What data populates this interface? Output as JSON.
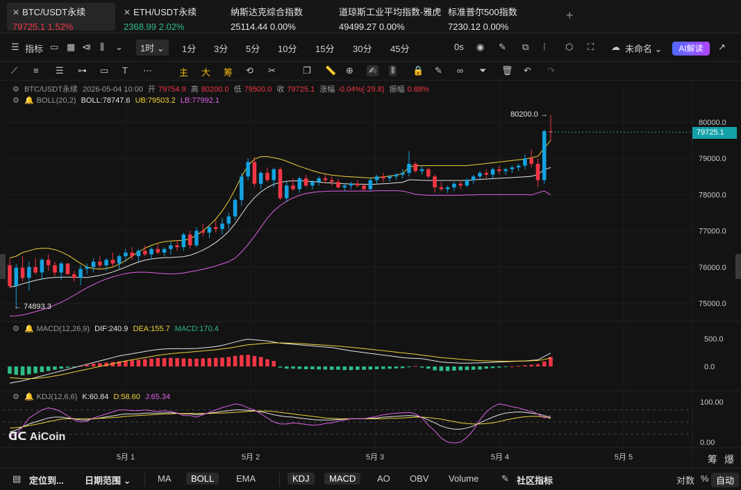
{
  "tabs": [
    {
      "name": "BTC/USDT永续",
      "price": "79725.1",
      "change": "1.52%",
      "dir": "down",
      "active": true
    },
    {
      "name": "ETH/USDT永续",
      "price": "2368.99",
      "change": "2.02%",
      "dir": "up",
      "active": false
    }
  ],
  "indices": [
    {
      "name": "纳斯达克综合指数",
      "price": "25114.44",
      "change": "0.00%"
    },
    {
      "name": "道琼斯工业平均指数-雅虎",
      "price": "49499.27",
      "change": "0.00%"
    },
    {
      "name": "标准普尔500指数",
      "price": "7230.12",
      "change": "0.00%"
    }
  ],
  "toolbar": {
    "indicators_label": "指标",
    "timeframe_selected": "1时",
    "timeframes": [
      "1分",
      "3分",
      "5分",
      "10分",
      "15分",
      "30分",
      "45分"
    ],
    "zero_sec": "0s",
    "unnamed_label": "未命名",
    "ai_label": "AI解读"
  },
  "drawbar": {
    "main_label": "主",
    "da_label": "大",
    "chip_label": "筹"
  },
  "ohlc": {
    "symbol": "BTC/USDT永续",
    "datetime": "2026-05-04 10:00",
    "open_label": "开",
    "open": "79754.9",
    "high_label": "高",
    "high": "80200.0",
    "low_label": "低",
    "low": "79500.0",
    "close_label": "收",
    "close": "79725.1",
    "change_label": "涨幅",
    "change": "-0.04%(-29.8)",
    "amp_label": "振幅",
    "amp": "0.88%"
  },
  "boll": {
    "title": "BOLL(20,2)",
    "boll": "BOLL:78747.6",
    "ub": "UB:79503.2",
    "lb": "LB:77992.1"
  },
  "macd": {
    "title": "MACD(12,26,9)",
    "dif": "DIF:240.9",
    "dea": "DEA:155.7",
    "macd": "MACD:170.4"
  },
  "kdj": {
    "title": "KDJ(12,6,6)",
    "k": "K:60.84",
    "d": "D:58.60",
    "j": "J:65.34"
  },
  "price_axis": [
    "80000.0",
    "79000.0",
    "78000.0",
    "77000.0",
    "76000.0",
    "75000.0"
  ],
  "macd_axis": [
    "500.0",
    "0.0"
  ],
  "kdj_axis": [
    "100.00",
    "0.00"
  ],
  "date_axis": [
    "5月 1",
    "5月 2",
    "5月 3",
    "5月 4",
    "5月 5"
  ],
  "last_price": "79725.1",
  "max_annotation": "80200.0 →",
  "min_annotation": "← 74893.3",
  "corner_right": [
    "筹",
    "爆"
  ],
  "logo_text": "AiCoin",
  "bottombar": {
    "locate": "定位到...",
    "range": "日期范围",
    "main_indicators": [
      "MA",
      "BOLL",
      "EMA"
    ],
    "main_selected": "BOLL",
    "sub_indicators": [
      "KDJ",
      "MACD",
      "AO",
      "OBV",
      "Volume"
    ],
    "community": "社区指标",
    "log_label": "对数",
    "pct_label": "%",
    "auto_label": "自动"
  },
  "colors": {
    "up": "#2ebd85",
    "down": "#f23645",
    "boll_mid": "#e6e6e6",
    "boll_ub": "#f0d43a",
    "boll_lb": "#e062e6",
    "macd_pos": "#f23645",
    "macd_neg": "#2ebd85",
    "accent": "#14a2a8"
  },
  "chart_data": {
    "type": "candlestick",
    "interval": "1h",
    "candles": [
      [
        76050,
        76230,
        75420,
        75480
      ],
      [
        75480,
        76080,
        74893.3,
        75980
      ],
      [
        75980,
        76300,
        75600,
        75700
      ],
      [
        75700,
        76150,
        75350,
        76000
      ],
      [
        76000,
        76250,
        75800,
        75850
      ],
      [
        75850,
        76250,
        75650,
        76200
      ],
      [
        76200,
        76350,
        75900,
        76050
      ],
      [
        76050,
        76150,
        75750,
        75850
      ],
      [
        75850,
        76150,
        75650,
        76100
      ],
      [
        76100,
        76050,
        75900,
        75800
      ],
      [
        75800,
        75900,
        75600,
        75700
      ],
      [
        75700,
        76050,
        75500,
        75950
      ],
      [
        75950,
        76100,
        75800,
        76000
      ],
      [
        76000,
        76250,
        75850,
        76150
      ],
      [
        76150,
        76300,
        75950,
        76050
      ],
      [
        76050,
        76250,
        75900,
        76200
      ],
      [
        76200,
        76400,
        76000,
        76100
      ],
      [
        76100,
        76350,
        75950,
        76300
      ],
      [
        76300,
        76500,
        76150,
        76400
      ],
      [
        76400,
        76550,
        76200,
        76300
      ],
      [
        76300,
        76500,
        76150,
        76450
      ],
      [
        76450,
        76600,
        76300,
        76350
      ],
      [
        76350,
        76550,
        76200,
        76500
      ],
      [
        76500,
        76650,
        76350,
        76400
      ],
      [
        76400,
        76550,
        76300,
        76500
      ],
      [
        76500,
        76700,
        76350,
        76600
      ],
      [
        76600,
        76750,
        76450,
        76550
      ],
      [
        76550,
        76950,
        76450,
        76900
      ],
      [
        76900,
        77000,
        76500,
        76600
      ],
      [
        76600,
        77100,
        76550,
        77000
      ],
      [
        77000,
        77200,
        76850,
        76950
      ],
      [
        76950,
        77150,
        76800,
        77100
      ],
      [
        77100,
        77300,
        76950,
        77050
      ],
      [
        77050,
        77350,
        76900,
        77200
      ],
      [
        77200,
        77500,
        77050,
        77400
      ],
      [
        77400,
        77900,
        77300,
        77850
      ],
      [
        77850,
        78600,
        77700,
        78500
      ],
      [
        78500,
        79000,
        78400,
        78900
      ],
      [
        78900,
        79050,
        78200,
        78300
      ],
      [
        78300,
        78650,
        78150,
        78600
      ],
      [
        78600,
        78750,
        78350,
        78400
      ],
      [
        78400,
        78750,
        78200,
        78700
      ],
      [
        78700,
        78750,
        77850,
        77900
      ],
      [
        77900,
        78350,
        77800,
        78250
      ],
      [
        78250,
        78450,
        78100,
        78150
      ],
      [
        78150,
        78500,
        78050,
        78450
      ],
      [
        78450,
        78550,
        78200,
        78250
      ],
      [
        78250,
        78400,
        78150,
        78350
      ],
      [
        78350,
        78500,
        78250,
        78450
      ],
      [
        78450,
        78550,
        78300,
        78400
      ],
      [
        78400,
        78500,
        78250,
        78350
      ],
      [
        78350,
        78450,
        78150,
        78200
      ],
      [
        78200,
        78300,
        78100,
        78250
      ],
      [
        78250,
        78350,
        78150,
        78300
      ],
      [
        78300,
        78400,
        78200,
        78250
      ],
      [
        78250,
        78300,
        78100,
        78150
      ],
      [
        78150,
        78450,
        78100,
        78400
      ],
      [
        78400,
        78550,
        78300,
        78500
      ],
      [
        78500,
        78600,
        78350,
        78450
      ],
      [
        78450,
        78550,
        78350,
        78500
      ],
      [
        78500,
        78600,
        78400,
        78550
      ],
      [
        78550,
        78700,
        78450,
        78600
      ],
      [
        78600,
        79200,
        78500,
        78850
      ],
      [
        78850,
        78900,
        78600,
        78650
      ],
      [
        78650,
        78800,
        78550,
        78700
      ],
      [
        78700,
        78750,
        78450,
        78500
      ],
      [
        78500,
        78550,
        78050,
        78200
      ],
      [
        78200,
        78350,
        78100,
        78150
      ],
      [
        78150,
        78250,
        78050,
        78200
      ],
      [
        78200,
        78350,
        78100,
        78300
      ],
      [
        78300,
        78400,
        78150,
        78250
      ],
      [
        78250,
        78450,
        78200,
        78400
      ],
      [
        78400,
        78550,
        78300,
        78500
      ],
      [
        78500,
        78650,
        78400,
        78600
      ],
      [
        78600,
        78700,
        78450,
        78550
      ],
      [
        78550,
        78750,
        78450,
        78700
      ],
      [
        78700,
        78800,
        78550,
        78650
      ],
      [
        78650,
        78750,
        78550,
        78700
      ],
      [
        78700,
        78800,
        78600,
        78750
      ],
      [
        78750,
        78850,
        78650,
        78800
      ],
      [
        78800,
        79100,
        78700,
        79000
      ],
      [
        79000,
        79250,
        78750,
        78850
      ],
      [
        78850,
        79000,
        78200,
        78400
      ],
      [
        78400,
        79800,
        78300,
        79750
      ],
      [
        79750,
        80200,
        79500,
        79725.1
      ]
    ],
    "boll_upper": [
      76250,
      76300,
      76400,
      76450,
      76500,
      76520,
      76520,
      76480,
      76420,
      76330,
      76220,
      76100,
      76000,
      75960,
      75940,
      75960,
      76000,
      76080,
      76180,
      76300,
      76420,
      76520,
      76600,
      76660,
      76700,
      76720,
      76730,
      76740,
      76780,
      76880,
      77000,
      77150,
      77330,
      77550,
      77820,
      78150,
      78500,
      78800,
      78980,
      79050,
      79050,
      79020,
      78980,
      78920,
      78850,
      78780,
      78720,
      78660,
      78610,
      78570,
      78540,
      78520,
      78500,
      78490,
      78480,
      78470,
      78460,
      78470,
      78490,
      78510,
      78540,
      78580,
      78760,
      78800,
      78800,
      78800,
      78800,
      78800,
      78800,
      78800,
      78800,
      78800,
      78820,
      78840,
      78860,
      78880,
      78900,
      78920,
      78940,
      78960,
      78980,
      79020,
      79060,
      79280,
      79503.2
    ],
    "boll_lower": [
      74650,
      74650,
      74680,
      74720,
      74770,
      74820,
      74880,
      74950,
      75030,
      75120,
      75220,
      75330,
      75430,
      75520,
      75600,
      75670,
      75730,
      75780,
      75820,
      75850,
      75860,
      75860,
      75850,
      75830,
      75820,
      75810,
      75820,
      75840,
      75870,
      75900,
      75940,
      75980,
      76030,
      76090,
      76150,
      76250,
      76420,
      76620,
      76850,
      77100,
      77350,
      77550,
      77700,
      77820,
      77910,
      77980,
      78030,
      78060,
      78080,
      78090,
      78100,
      78100,
      78100,
      78100,
      78100,
      78100,
      78100,
      78110,
      78110,
      78110,
      78110,
      78100,
      78060,
      78010,
      77990,
      77980,
      77980,
      77980,
      77980,
      77980,
      77980,
      77990,
      77990,
      78000,
      78000,
      78000,
      78000,
      78000,
      78000,
      78000,
      78000,
      77990,
      78050,
      78100,
      77992.1
    ],
    "macd_hist": [
      -130,
      -150,
      -160,
      -140,
      -120,
      -100,
      -80,
      -60,
      -40,
      -20,
      -5,
      10,
      30,
      50,
      60,
      70,
      80,
      90,
      100,
      110,
      120,
      130,
      140,
      150,
      150,
      155,
      150,
      145,
      140,
      140,
      145,
      150,
      155,
      160,
      170,
      190,
      205,
      210,
      190,
      170,
      130,
      100,
      -20,
      -40,
      -40,
      -45,
      -50,
      -50,
      -55,
      -55,
      -60,
      -60,
      -65,
      -65,
      -60,
      -60,
      -55,
      -50,
      -45,
      -40,
      -35,
      -30,
      -5,
      10,
      -20,
      -40,
      -70,
      -80,
      -80,
      -75,
      -70,
      -65,
      -60,
      -55,
      -40,
      -30,
      -20,
      -10,
      0,
      10,
      20,
      30,
      40,
      90,
      170.4
    ],
    "macd_dif": [
      -300,
      -280,
      -260,
      -230,
      -200,
      -170,
      -140,
      -110,
      -80,
      -50,
      -20,
      10,
      40,
      70,
      100,
      130,
      160,
      190,
      210,
      230,
      250,
      270,
      290,
      305,
      315,
      320,
      320,
      320,
      320,
      325,
      335,
      345,
      360,
      380,
      410,
      440,
      470,
      490,
      480,
      470,
      460,
      440,
      420,
      410,
      400,
      390,
      380,
      370,
      360,
      350,
      340,
      320,
      300,
      280,
      265,
      250,
      235,
      220,
      205,
      190,
      175,
      160,
      150,
      145,
      140,
      120,
      100,
      80,
      70,
      65,
      60,
      60,
      62,
      66,
      70,
      75,
      80,
      85,
      90,
      95,
      100,
      110,
      120,
      180,
      240.9
    ],
    "macd_dea": [
      -200,
      -210,
      -220,
      -220,
      -215,
      -205,
      -190,
      -170,
      -150,
      -125,
      -100,
      -75,
      -50,
      -25,
      0,
      25,
      50,
      75,
      100,
      120,
      140,
      160,
      180,
      200,
      215,
      230,
      240,
      250,
      260,
      270,
      280,
      290,
      300,
      315,
      330,
      350,
      370,
      390,
      400,
      410,
      420,
      425,
      425,
      422,
      418,
      412,
      405,
      398,
      390,
      382,
      374,
      365,
      355,
      345,
      335,
      322,
      310,
      297,
      284,
      271,
      258,
      245,
      232,
      220,
      205,
      190,
      175,
      160,
      150,
      140,
      130,
      120,
      112,
      105,
      100,
      97,
      95,
      95,
      95,
      96,
      98,
      102,
      108,
      125,
      155.7
    ],
    "kdj_k": [
      25,
      30,
      38,
      45,
      50,
      55,
      60,
      62,
      62,
      60,
      58,
      55,
      55,
      58,
      60,
      63,
      65,
      68,
      70,
      70,
      70,
      72,
      72,
      72,
      73,
      73,
      72,
      70,
      70,
      68,
      70,
      72,
      74,
      76,
      78,
      80,
      80,
      79,
      78,
      75,
      72,
      68,
      65,
      63,
      62,
      60,
      58,
      56,
      55,
      55,
      55,
      56,
      57,
      58,
      58,
      58,
      59,
      60,
      62,
      63,
      64,
      65,
      66,
      65,
      62,
      55,
      48,
      40,
      35,
      32,
      32,
      35,
      40,
      48,
      55,
      62,
      68,
      72,
      74,
      75,
      74,
      72,
      70,
      66,
      60.84
    ],
    "kdj_d": [
      35,
      36,
      38,
      41,
      44,
      47,
      51,
      54,
      57,
      58,
      58,
      58,
      58,
      58,
      59,
      60,
      61,
      62,
      64,
      65,
      66,
      67,
      68,
      69,
      70,
      70,
      71,
      71,
      71,
      71,
      71,
      71,
      72,
      72,
      73,
      74,
      75,
      76,
      77,
      77,
      77,
      76,
      74,
      72,
      70,
      68,
      66,
      64,
      62,
      60,
      59,
      58,
      58,
      58,
      58,
      58,
      58,
      58,
      58,
      59,
      59,
      60,
      61,
      62,
      62,
      61,
      59,
      57,
      54,
      51,
      48,
      46,
      45,
      45,
      46,
      48,
      51,
      55,
      58,
      61,
      63,
      64,
      64,
      63,
      58.6
    ],
    "kdj_j": [
      15,
      20,
      38,
      60,
      70,
      80,
      85,
      82,
      75,
      65,
      55,
      50,
      52,
      60,
      65,
      70,
      75,
      80,
      80,
      78,
      78,
      80,
      78,
      76,
      78,
      76,
      72,
      66,
      66,
      62,
      68,
      74,
      80,
      86,
      90,
      95,
      92,
      85,
      80,
      70,
      60,
      50,
      45,
      45,
      48,
      46,
      44,
      42,
      43,
      46,
      48,
      52,
      55,
      58,
      58,
      58,
      61,
      64,
      68,
      70,
      72,
      73,
      74,
      70,
      60,
      42,
      28,
      10,
      0,
      -2,
      0,
      12,
      30,
      55,
      75,
      88,
      95,
      92,
      88,
      85,
      80,
      76,
      70,
      60,
      65.34
    ]
  }
}
